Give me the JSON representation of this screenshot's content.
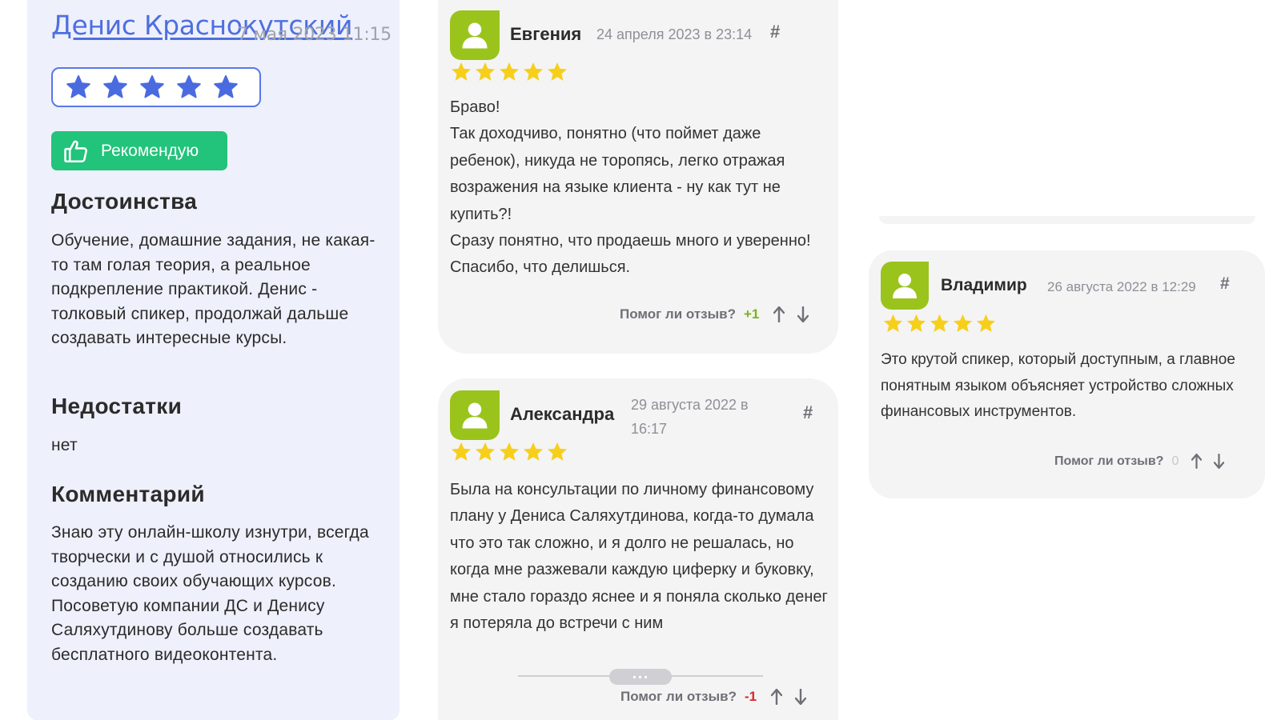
{
  "left_review": {
    "author": "Денис Краснокутский",
    "date": "7 мая 2023 11:15",
    "rating": 5,
    "recommend_label": "Рекомендую",
    "pros_title": "Достоинства",
    "pros_text": "Обучение, домашние задания, не какая-то там голая теория, а реальное подкрепление практикой. Денис - толковый спикер, продолжай дальше создавать интересные курсы.",
    "cons_title": "Недостатки",
    "cons_text": "нет",
    "comment_title": "Комментарий",
    "comment_text": "Знаю эту онлайн-школу изнутри, всегда творчески и с душой относились к созданию своих обучающих курсов. Посоветую компании ДС и Денису Саляхутдинову больше создавать бесплатного видеоконтента."
  },
  "reviews": [
    {
      "name": "Евгения",
      "date": "24 апреля 2023 в 23:14",
      "hash": "#",
      "rating": 5,
      "lines": [
        "Браво!",
        "Так доходчиво, понятно (что поймет даже ребенок), никуда не торопясь, легко отражая возражения на языке клиента - ну как тут не купить?!",
        "Сразу понятно, что продаешь много и уверенно!",
        "Спасибо, что делишься."
      ],
      "helpful_label": "Помог ли отзыв?",
      "helpful_score": "+1"
    },
    {
      "name": "Александра",
      "date": "29 августа 2022 в 16:17",
      "hash": "#",
      "rating": 5,
      "lines": [
        "Была на консультации по личному финансовому плану у Дениса Саляхутдинова, когда-то думала что это так сложно, и я долго не решалась, но когда мне разжевали каждую циферку и буковку, мне стало гораздо яснее и я поняла сколько денег я потеряла до встречи с ним"
      ],
      "expand_label": "···",
      "helpful_label": "Помог ли отзыв?",
      "helpful_score": "-1"
    },
    {
      "name": "Владимир",
      "date": "26 августа 2022 в 12:29",
      "hash": "#",
      "rating": 5,
      "lines": [
        "Это крутой спикер, который доступным, а главное понятным языком объясняет устройство сложных финансовых инструментов."
      ],
      "helpful_label": "Помог ли отзыв?",
      "helpful_score": "0"
    }
  ],
  "colors": {
    "panel_bg": "#eef0fb",
    "link": "#4e6fe0",
    "rating_star_blue": "#4a6be0",
    "recommend_green": "#22c37a",
    "avatar_green": "#9ac41c",
    "star_yellow": "#f7cf1b",
    "score_positive": "#7cb518",
    "score_negative": "#d62828",
    "score_zero": "#c8c8cc"
  },
  "icons": {
    "rating_star": "star-icon",
    "recommend": "thumbs-up-icon",
    "avatar": "user-avatar-icon",
    "vote_up": "arrow-up-icon",
    "vote_down": "arrow-down-icon"
  }
}
